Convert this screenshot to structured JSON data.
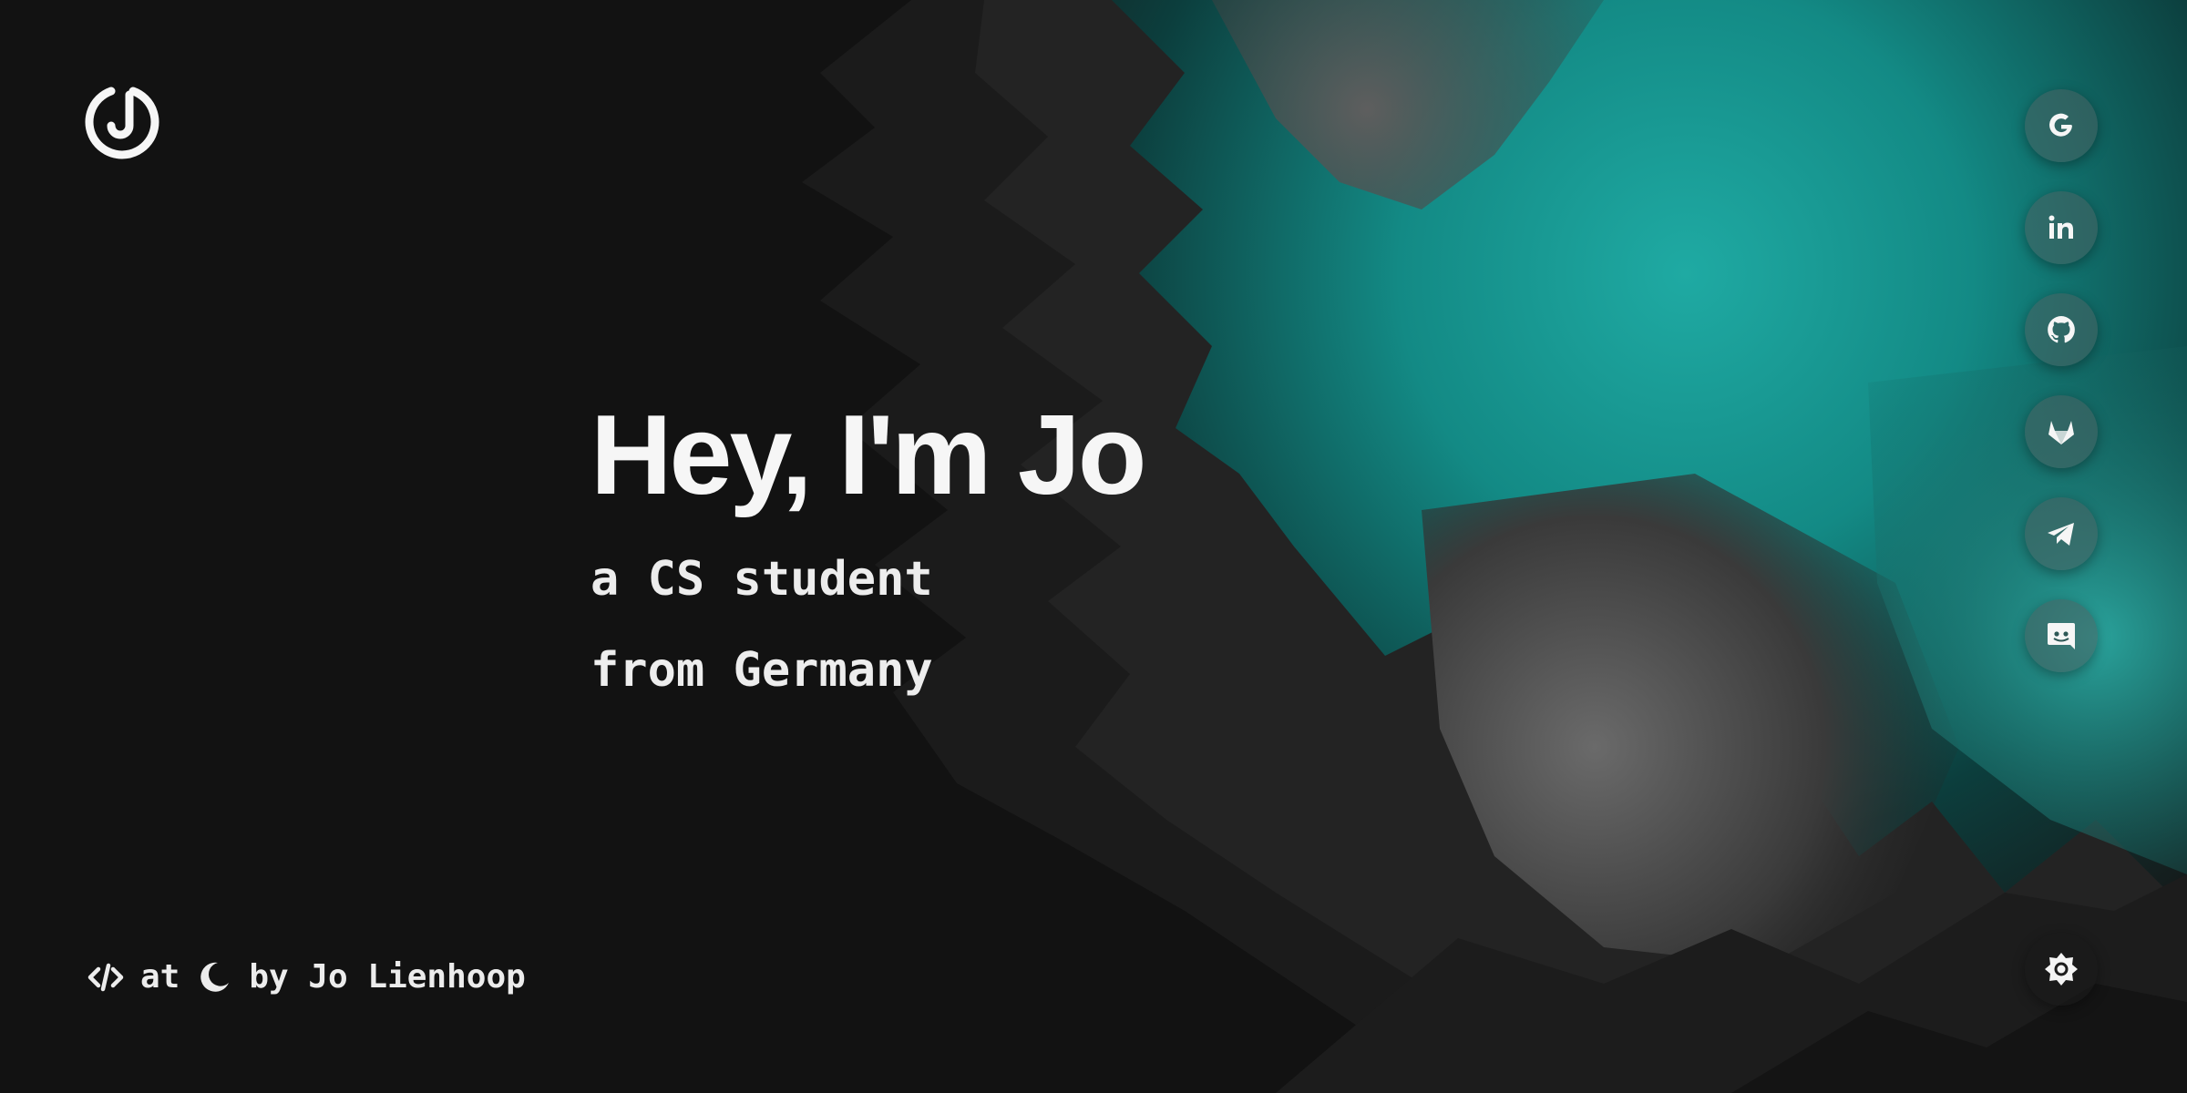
{
  "hero": {
    "title": "Hey, I'm Jo",
    "line1": "a CS student",
    "line2": "from Germany"
  },
  "footer": {
    "at": "at",
    "by": "by Jo Lienhoop"
  },
  "icons": {
    "logo": "jo-logo-icon",
    "social": [
      "google-icon",
      "linkedin-icon",
      "github-icon",
      "gitlab-icon",
      "telegram-icon",
      "discord-icon"
    ],
    "footer": [
      "code-icon",
      "moon-icon"
    ],
    "theme": "sun-icon"
  },
  "colors": {
    "background": "#121212",
    "accent": "#1a9a94",
    "text": "#f4f4f4"
  }
}
